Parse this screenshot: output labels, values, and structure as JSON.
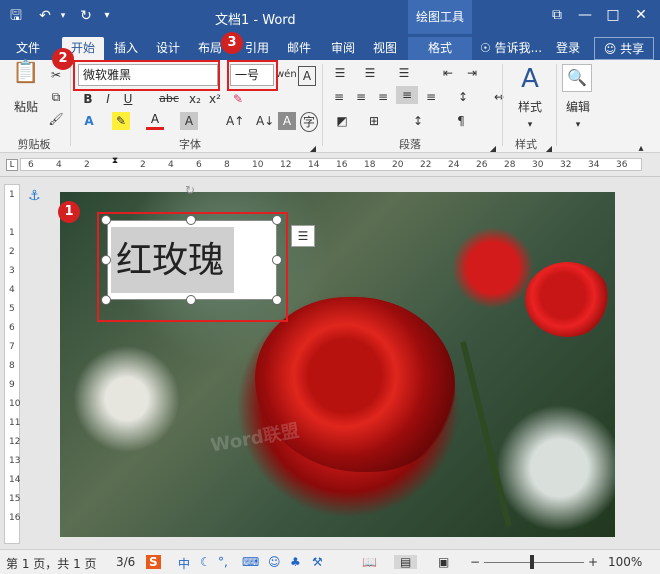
{
  "titlebar": {
    "title": "文档1 - Word",
    "drawing_tools": "绘图工具",
    "save_icon": "save-icon",
    "undo_icon": "undo-icon",
    "redo_icon": "redo-icon",
    "customize_icon": "customize-icon",
    "ribbon_display_icon": "ribbon-display-icon",
    "min_icon": "minimize-icon",
    "max_icon": "maximize-icon",
    "close_icon": "close-icon"
  },
  "tabs": {
    "file": "文件",
    "home": "开始",
    "insert": "插入",
    "design": "设计",
    "layout": "布局",
    "references": "引用",
    "mailings": "邮件",
    "review": "审阅",
    "view": "视图",
    "format": "格式",
    "tell": "告诉我...",
    "login": "登录",
    "share": "共享"
  },
  "ribbon": {
    "clipboard": {
      "paste": "粘贴",
      "label": "剪贴板"
    },
    "font": {
      "name": "微软雅黑",
      "size": "一号",
      "bold": "B",
      "italic": "I",
      "underline": "U",
      "strike": "abc",
      "sub": "x₂",
      "sup": "x²",
      "label": "字体"
    },
    "paragraph": {
      "label": "段落"
    },
    "styles": {
      "label": "样式",
      "btn": "样式"
    },
    "editing": {
      "label": "编辑",
      "btn": "编辑"
    }
  },
  "ruler_h": [
    "6",
    "4",
    "2",
    "",
    "2",
    "4",
    "6",
    "8",
    "10",
    "12",
    "14",
    "16",
    "18",
    "20",
    "22",
    "24",
    "26",
    "28",
    "30",
    "32",
    "34",
    "36"
  ],
  "ruler_v": [
    "1",
    "",
    "1",
    "2",
    "3",
    "4",
    "5",
    "6",
    "7",
    "8",
    "9",
    "10",
    "11",
    "12",
    "13",
    "14",
    "15",
    "16"
  ],
  "textbox": {
    "text": "红玫瑰"
  },
  "annotations": {
    "b1": "1",
    "b2": "2",
    "b3": "3"
  },
  "watermark": "Word联盟",
  "status": {
    "page": "第 1 页，共 1 页",
    "pages": "3/6",
    "ime_cn": "中",
    "zoom": "100%"
  }
}
